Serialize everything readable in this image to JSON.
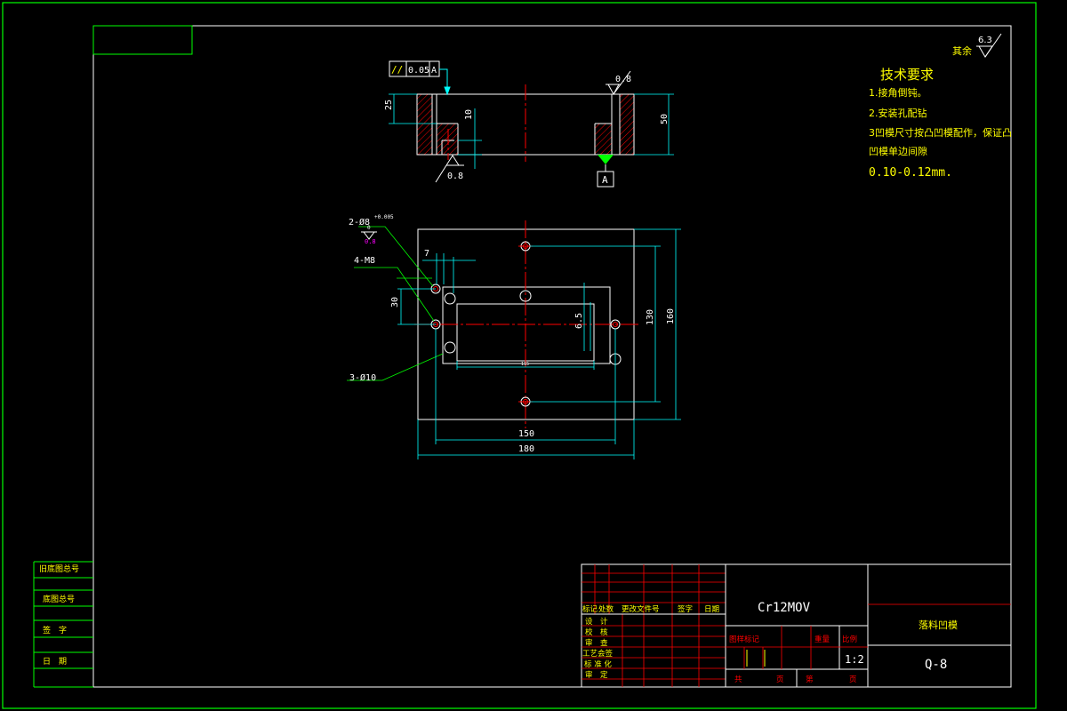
{
  "tech": {
    "heading": "技术要求",
    "line1": "1.接角倒钝。",
    "line2": "2.安装孔配钻",
    "line3": "3凹模尺寸按凸凹模配作，保证凸",
    "line4": "凹模单边间隙",
    "line5": "0.10-0.12mm."
  },
  "roughness": {
    "rest_label": "其余",
    "rest_value": "6.3",
    "value_08": "0.8"
  },
  "section_view": {
    "tolerance_frame": [
      "//",
      "0.05",
      "A"
    ],
    "datum": "A",
    "dim_25": "25",
    "dim_10": "10",
    "dim_50": "50",
    "rough_top": "0.8",
    "rough_bottom": "0.8"
  },
  "plan_view": {
    "callout_pin_holes": "2-Ø8",
    "callout_pin_tol": "+0.005",
    "callout_pin_tol0": "0",
    "callout_pin_rough": "0.8",
    "callout_threads": "4-M8",
    "callout_holes": "3-Ø10",
    "dim_7": "7",
    "dim_30": "30",
    "dim_65": "6.5",
    "dim_115": "115",
    "dim_130": "130",
    "dim_160": "160",
    "dim_150": "150",
    "dim_180": "180"
  },
  "left_table": {
    "row1": "旧底图总号",
    "row2": "底图总号",
    "row3": "签　字",
    "row4": "日　期"
  },
  "title_block": {
    "hdr_mark": "标记",
    "hdr_count": "处数",
    "hdr_docno": "更改文件号",
    "hdr_sign": "签字",
    "hdr_date": "日期",
    "role_design": "设　计",
    "role_check": "校　核",
    "role_review": "审　查",
    "role_process": "工艺会签",
    "role_standard": "标 准 化",
    "role_approve": "审　定",
    "material": "Cr12MOV",
    "part_name": "落料凹模",
    "drawing_no": "Q-8",
    "label_stage": "图样标记",
    "label_weight": "重量",
    "label_scale": "比例",
    "scale": "1:2",
    "sheets_total_a": "共",
    "sheets_total_b": "页",
    "sheet_no_a": "第",
    "sheet_no_b": "页"
  },
  "colors": {
    "frame": "#00ff00",
    "geometry": "#ffffff",
    "center": "#ff0000",
    "dimension": "#00ffff",
    "text": "#ffff00",
    "hatch": "#ff0000",
    "tol": "#ff00ff"
  }
}
